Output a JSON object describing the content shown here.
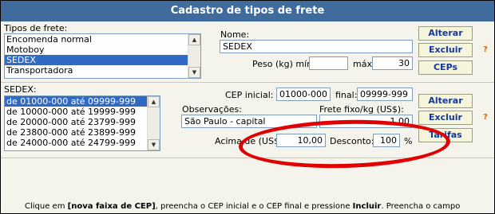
{
  "title": "Cadastro de tipos de frete",
  "frete": {
    "list_label": "Tipos de frete:",
    "items": [
      "Encomenda normal",
      "Motoboy",
      "SEDEX",
      "Transportadora"
    ],
    "selected_index": 2,
    "nome_label": "Nome:",
    "nome_value": "SEDEX",
    "peso_min_label": "Peso (kg) mín:",
    "peso_min_value": "",
    "peso_max_label": "máx:",
    "peso_max_value": "30",
    "btn_alterar": "Alterar",
    "btn_excluir": "Excluir",
    "btn_ceps": "CEPs",
    "help_symbol": "?"
  },
  "faixas": {
    "list_label": "SEDEX:",
    "items": [
      "de 01000-000 até 09999-999",
      "de 10000-000 até 19999-999",
      "de 20000-000 até 23799-999",
      "de 23800-000 até 23899-999",
      "de 24000-000 até 24799-999"
    ],
    "selected_index": 0,
    "cep_inicial_label": "CEP inicial:",
    "cep_inicial_value": "01000-000",
    "final_label": "final:",
    "final_value": "09999-999",
    "obs_label": "Observações:",
    "obs_value": "São Paulo - capital",
    "frete_fixo_label": "Frete fixo/kg (US$):",
    "frete_fixo_value": "1,00",
    "acima_label": "Acima de (US$):",
    "acima_value": "10,00",
    "desconto_label": "Desconto:",
    "desconto_value": "100",
    "pct": "%",
    "btn_alterar": "Alterar",
    "btn_excluir": "Excluir",
    "btn_tarifas": "Tarifas",
    "help_symbol": "?"
  },
  "instructions": {
    "text_1": "Clique em ",
    "bold_1": "[nova faixa de CEP]",
    "text_2": ", preencha o CEP inicial e o CEP final e pressione ",
    "bold_2": "Incluir",
    "text_3": ". Preencha o campo"
  },
  "colors": {
    "title_bar": "#3f6c9c",
    "selection": "#316ac5",
    "button_text": "#13379b",
    "annotation": "#e00000"
  }
}
